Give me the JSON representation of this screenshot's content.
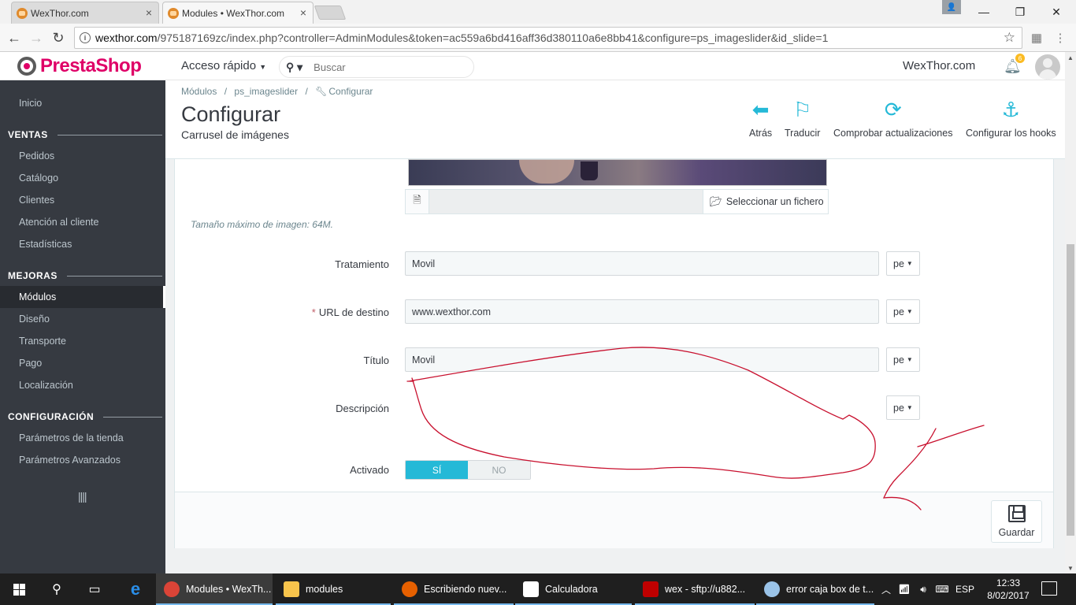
{
  "browser": {
    "tabs": [
      {
        "title": "WexThor.com"
      },
      {
        "title": "Modules • WexThor.com"
      }
    ],
    "url_host": "wexthor.com",
    "url_path": "/975187169zc/index.php?controller=AdminModules&token=ac559a6bd416aff36d380110a6e8bb41&configure=ps_imageslider&id_slide=1"
  },
  "header": {
    "logo_text": "PrestaShop",
    "quick_access": "Acceso rápido",
    "search_placeholder": "Buscar",
    "shop_name": "WexThor.com",
    "notification_count": "6"
  },
  "sidebar": {
    "home": "Inicio",
    "sections": [
      {
        "title": "VENTAS",
        "items": [
          "Pedidos",
          "Catálogo",
          "Clientes",
          "Atención al cliente",
          "Estadísticas"
        ]
      },
      {
        "title": "MEJORAS",
        "items": [
          "Módulos",
          "Diseño",
          "Transporte",
          "Pago",
          "Localización"
        ]
      },
      {
        "title": "CONFIGURACIÓN",
        "items": [
          "Parámetros de la tienda",
          "Parámetros Avanzados"
        ]
      }
    ],
    "active_item": "Módulos"
  },
  "page": {
    "breadcrumb": [
      "Módulos",
      "ps_imageslider",
      "Configurar"
    ],
    "title": "Configurar",
    "subtitle": "Carrusel de imágenes",
    "toolbar": [
      {
        "label": "Atrás",
        "icon": "arrow-left-circle-icon"
      },
      {
        "label": "Traducir",
        "icon": "flag-icon"
      },
      {
        "label": "Comprobar actualizaciones",
        "icon": "refresh-icon"
      },
      {
        "label": "Configurar los hooks",
        "icon": "anchor-icon"
      }
    ]
  },
  "form": {
    "file_button": "Seleccionar un fichero",
    "max_size_note": "Tamaño máximo de imagen: 64M.",
    "fields": {
      "tratamiento": {
        "label": "Tratamiento",
        "value": "Movil"
      },
      "url": {
        "label": "URL de destino",
        "value": "www.wexthor.com",
        "required": true
      },
      "titulo": {
        "label": "Título",
        "value": "Movil"
      },
      "descripcion": {
        "label": "Descripción",
        "value": ""
      }
    },
    "lang_code": "pe",
    "activado": {
      "label": "Activado",
      "yes": "SÍ",
      "no": "NO",
      "value": true
    },
    "save_label": "Guardar"
  },
  "taskbar": {
    "apps": [
      {
        "label": "Modules • WexTh...",
        "color": "#db4437",
        "active": true
      },
      {
        "label": "modules",
        "color": "#f8c44c"
      },
      {
        "label": "Escribiendo nuev...",
        "color": "#e66000"
      },
      {
        "label": "Calculadora",
        "color": "#ffffff"
      },
      {
        "label": "wex - sftp://u882...",
        "color": "#bf0000"
      },
      {
        "label": "error caja box de t...",
        "color": "#9ac3e8"
      }
    ],
    "language": "ESP",
    "time": "12:33",
    "date": "8/02/2017"
  },
  "colors": {
    "brand": "#df0067",
    "accent": "#25b9d7",
    "sidebar_bg": "#363a41",
    "scribble": "#c8102e"
  }
}
